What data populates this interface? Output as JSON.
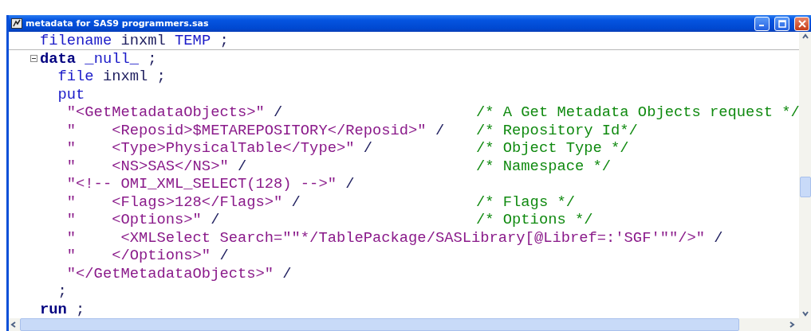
{
  "window": {
    "title": "metadata for SAS9 programmers.sas"
  },
  "editor": {
    "lines": [
      {
        "segments": [
          {
            "kind": "statement",
            "text": "filename"
          },
          {
            "kind": "plain",
            "text": " inxml "
          },
          {
            "kind": "statement",
            "text": "TEMP"
          },
          {
            "kind": "plain",
            "text": " ;"
          }
        ],
        "separator_below": true
      },
      {
        "segments": [
          {
            "kind": "keyword",
            "text": "data"
          },
          {
            "kind": "statement",
            "text": " _null_"
          },
          {
            "kind": "plain",
            "text": " ;"
          }
        ],
        "expanded": true
      },
      {
        "segments": [
          {
            "kind": "statement",
            "text": "  file"
          },
          {
            "kind": "plain",
            "text": " inxml ;"
          }
        ]
      },
      {
        "segments": [
          {
            "kind": "statement",
            "text": "  put"
          }
        ]
      },
      {
        "segments": [
          {
            "kind": "string",
            "text": "   \"<GetMetadataObjects>\""
          },
          {
            "kind": "plain",
            "text": " /"
          }
        ],
        "comment": "/* A Get Metadata Objects request */"
      },
      {
        "segments": [
          {
            "kind": "string",
            "text": "   \"    <Reposid>$METAREPOSITORY</Reposid>\""
          },
          {
            "kind": "plain",
            "text": " /"
          }
        ],
        "comment": "/* Repository Id*/"
      },
      {
        "segments": [
          {
            "kind": "string",
            "text": "   \"    <Type>PhysicalTable</Type>\""
          },
          {
            "kind": "plain",
            "text": " /"
          }
        ],
        "comment": "/* Object Type */"
      },
      {
        "segments": [
          {
            "kind": "string",
            "text": "   \"    <NS>SAS</NS>\""
          },
          {
            "kind": "plain",
            "text": " /"
          }
        ],
        "comment": "/* Namespace */"
      },
      {
        "segments": [
          {
            "kind": "string",
            "text": "   \"<!-- OMI_XML_SELECT(128) -->\""
          },
          {
            "kind": "plain",
            "text": " /"
          }
        ]
      },
      {
        "segments": [
          {
            "kind": "string",
            "text": "   \"    <Flags>128</Flags>\""
          },
          {
            "kind": "plain",
            "text": " /"
          }
        ],
        "comment": "/* Flags */"
      },
      {
        "segments": [
          {
            "kind": "string",
            "text": "   \"    <Options>\""
          },
          {
            "kind": "plain",
            "text": " /"
          }
        ],
        "comment": "/* Options */"
      },
      {
        "segments": [
          {
            "kind": "string",
            "text": "   \"     <XMLSelect Search=\"\"*/TablePackage/SASLibrary[@Libref=:'SGF'\"\"/>\""
          },
          {
            "kind": "plain",
            "text": " /"
          }
        ]
      },
      {
        "segments": [
          {
            "kind": "string",
            "text": "   \"    </Options>\""
          },
          {
            "kind": "plain",
            "text": " /"
          }
        ]
      },
      {
        "segments": [
          {
            "kind": "string",
            "text": "   \"</GetMetadataObjects>\""
          },
          {
            "kind": "plain",
            "text": " /"
          }
        ]
      },
      {
        "segments": [
          {
            "kind": "plain",
            "text": "  ;"
          }
        ]
      },
      {
        "segments": [
          {
            "kind": "keyword",
            "text": "run"
          },
          {
            "kind": "plain",
            "text": " ;"
          }
        ]
      }
    ]
  }
}
